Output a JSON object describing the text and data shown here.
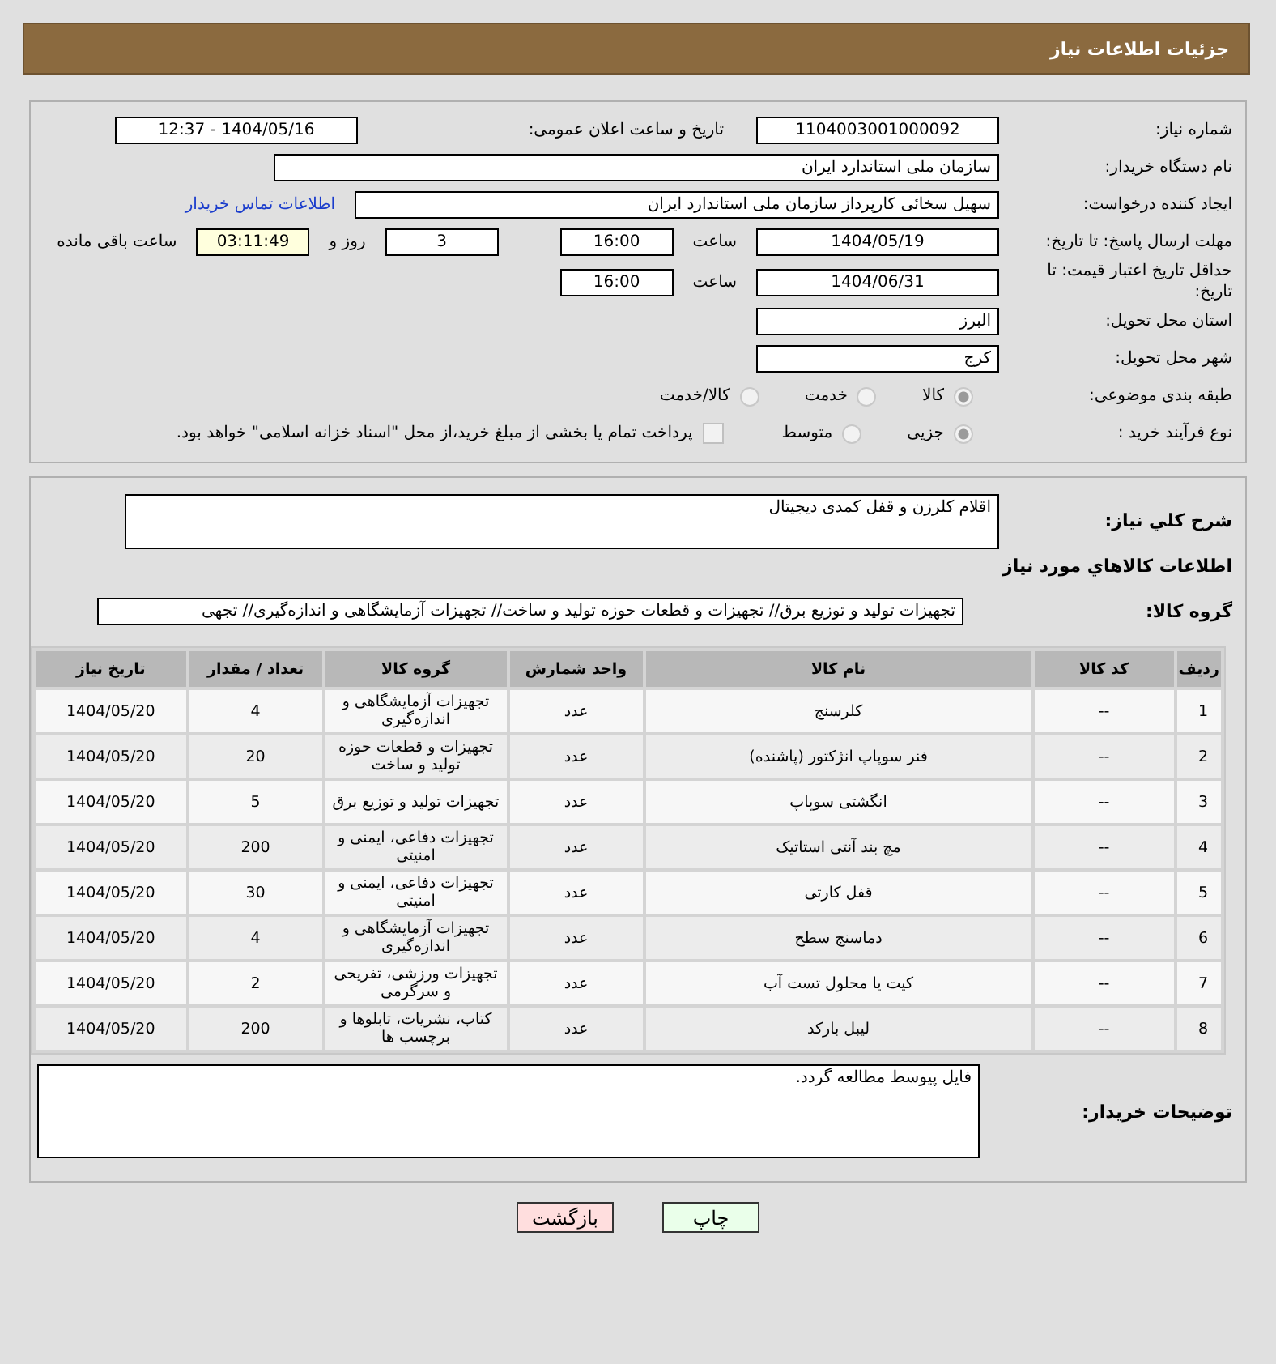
{
  "header": {
    "title": "جزئیات اطلاعات نیاز"
  },
  "details": {
    "need_number": {
      "label": "شماره نیاز:",
      "value": "1104003001000092"
    },
    "announce": {
      "label": "تاریخ و ساعت اعلان عمومی:",
      "value": "1404/05/16 - 12:37"
    },
    "buyer": {
      "label": "نام دستگاه خریدار:",
      "value": "سازمان ملی استاندارد ایران"
    },
    "creator": {
      "label": "ایجاد کننده درخواست:",
      "value": "سهیل سخائی کارپرداز سازمان ملی استاندارد ایران",
      "link": "اطلاعات تماس خریدار"
    },
    "deadline": {
      "label": "مهلت ارسال پاسخ: تا تاریخ:",
      "date": "1404/05/19",
      "time_label": "ساعت",
      "time": "16:00",
      "days": "3",
      "days_label": "روز و",
      "remaining": "03:11:49",
      "remaining_label": "ساعت باقی مانده"
    },
    "validity": {
      "label": "حداقل تاریخ اعتبار قیمت: تا تاریخ:",
      "date": "1404/06/31",
      "time_label": "ساعت",
      "time": "16:00"
    },
    "province": {
      "label": "استان محل تحویل:",
      "value": "البرز"
    },
    "city": {
      "label": "شهر محل تحویل:",
      "value": "کرج"
    },
    "category": {
      "label": "طبقه بندی موضوعی:",
      "options": [
        {
          "label": "کالا",
          "selected": true
        },
        {
          "label": "خدمت",
          "selected": false
        },
        {
          "label": "کالا/خدمت",
          "selected": false
        }
      ]
    },
    "process": {
      "label": "نوع فرآیند خرید :",
      "options": [
        {
          "label": "جزیی",
          "selected": true
        },
        {
          "label": "متوسط",
          "selected": false
        }
      ],
      "payment": {
        "checked": false,
        "text": "پرداخت تمام یا بخشی از مبلغ خرید،از محل \"اسناد خزانه اسلامی\" خواهد بود."
      }
    }
  },
  "goods": {
    "description": {
      "label": "شرح کلي نياز:",
      "value": "اقلام کلرزن و قفل کمدی دیجیتال"
    },
    "heading": "اطلاعات کالاهاي مورد نياز",
    "group": {
      "label": "گروه کالا:",
      "value": "تجهیزات تولید و توزیع برق// تجهیزات و قطعات حوزه تولید و ساخت// تجهیزات آزمایشگاهی و اندازه‌گیری// تجهی"
    },
    "table": {
      "columns": [
        "ردیف",
        "کد کالا",
        "نام کالا",
        "واحد شمارش",
        "گروه کالا",
        "تعداد / مقدار",
        "تاریخ نیاز"
      ],
      "rows": [
        [
          "1",
          "--",
          "کلرسنج",
          "عدد",
          "تجهیزات آزمایشگاهی و اندازه‌گیری",
          "4",
          "1404/05/20"
        ],
        [
          "2",
          "--",
          "فنر سوپاپ انژکتور (پاشنده)",
          "عدد",
          "تجهیزات و قطعات حوزه تولید و ساخت",
          "20",
          "1404/05/20"
        ],
        [
          "3",
          "--",
          "انگشتی سوپاپ",
          "عدد",
          "تجهیزات تولید و توزیع برق",
          "5",
          "1404/05/20"
        ],
        [
          "4",
          "--",
          "مچ بند آنتی استاتیک",
          "عدد",
          "تجهیزات دفاعی، ایمنی و امنیتی",
          "200",
          "1404/05/20"
        ],
        [
          "5",
          "--",
          "قفل کارتی",
          "عدد",
          "تجهیزات دفاعی، ایمنی و امنیتی",
          "30",
          "1404/05/20"
        ],
        [
          "6",
          "--",
          "دماسنج سطح",
          "عدد",
          "تجهیزات آزمایشگاهی و اندازه‌گیری",
          "4",
          "1404/05/20"
        ],
        [
          "7",
          "--",
          "کیت یا محلول تست آب",
          "عدد",
          "تجهیزات ورزشی، تفریحی و سرگرمی",
          "2",
          "1404/05/20"
        ],
        [
          "8",
          "--",
          "لیبل بارکد",
          "عدد",
          "کتاب، نشریات، تابلوها و برچسب ها",
          "200",
          "1404/05/20"
        ]
      ]
    },
    "notes": {
      "label": "توضیحات خریدار:",
      "value": "فایل پیوسط مطالعه گردد."
    }
  },
  "buttons": [
    {
      "label": "چاپ",
      "kind": "print"
    },
    {
      "label": "بازگشت",
      "kind": "back"
    }
  ]
}
